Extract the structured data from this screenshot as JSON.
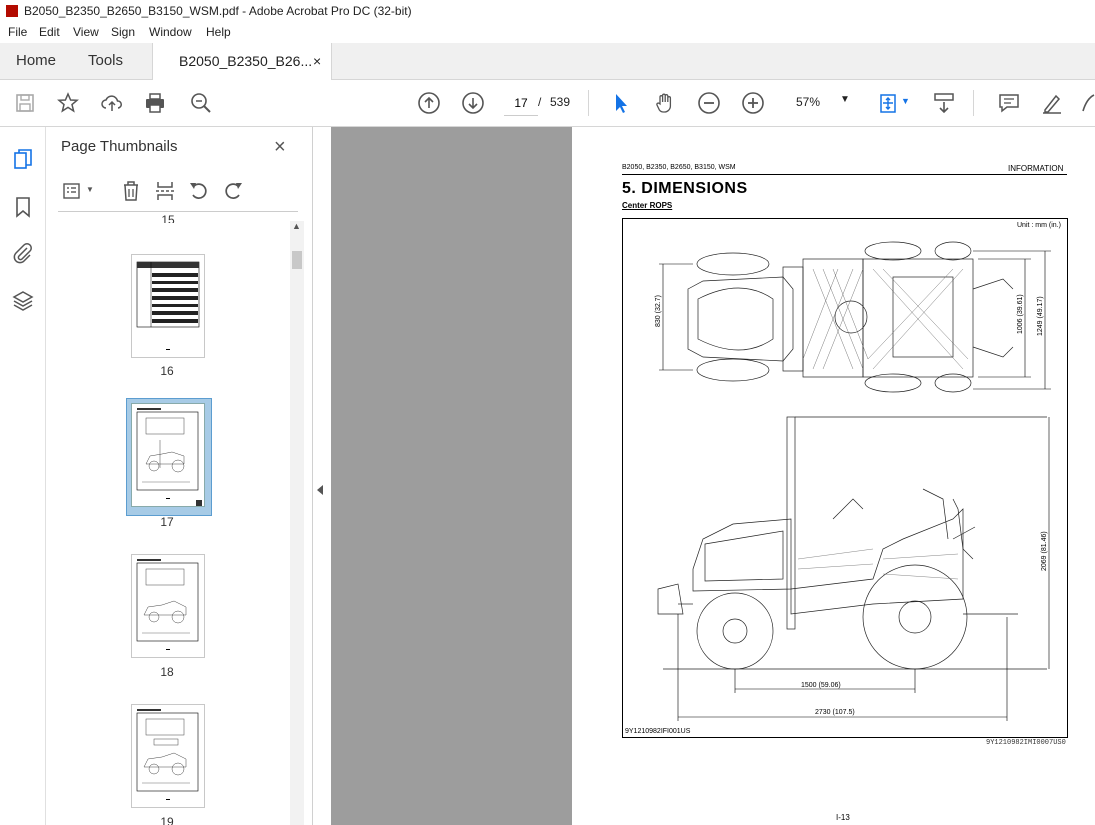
{
  "window": {
    "title": "B2050_B2350_B2650_B3150_WSM.pdf - Adobe Acrobat Pro DC (32-bit)"
  },
  "menu": [
    "File",
    "Edit",
    "View",
    "Sign",
    "Window",
    "Help"
  ],
  "tabs": {
    "home": "Home",
    "tools": "Tools",
    "document": "B2050_B2350_B26...",
    "close": "×"
  },
  "toolbar": {
    "current_page": "17",
    "page_separator": "/",
    "total_pages": "539",
    "zoom": "57%",
    "icons": [
      "save-icon",
      "bookmark-star-icon",
      "upload-cloud-icon",
      "print-icon",
      "zoom-search-icon",
      "prev-page-icon",
      "next-page-icon",
      "select-arrow-icon",
      "hand-tool-icon",
      "zoom-out-icon",
      "zoom-in-icon",
      "fit-page-icon",
      "scroll-mode-icon",
      "comment-icon",
      "highlight-pen-icon",
      "draw-icon"
    ]
  },
  "thumbnails": {
    "title": "Page Thumbnails",
    "close": "×",
    "partial_label": "15",
    "pages": [
      {
        "label": "16",
        "selected": false
      },
      {
        "label": "17",
        "selected": true
      },
      {
        "label": "18",
        "selected": false
      },
      {
        "label": "19",
        "selected": false
      }
    ]
  },
  "document_page": {
    "header_left": "B2050, B2350, B2650, B3150, WSM",
    "header_right": "INFORMATION",
    "section_title": "5.  DIMENSIONS",
    "subtitle": "Center ROPS",
    "unit_note": "Unit : mm (in.)",
    "dimensions": {
      "d830": "830 (32.7)",
      "d1006": "1006 (39.61)",
      "d1249": "1249 (49.17)",
      "d2069": "2069 (81.46)",
      "d1500": "1500 (59.06)",
      "d2730": "2730 (107.5)"
    },
    "figure_code": "9Y1210982IFI001US",
    "ref_code": "9Y1210982IMI0007US0",
    "page_number": "I-13"
  }
}
